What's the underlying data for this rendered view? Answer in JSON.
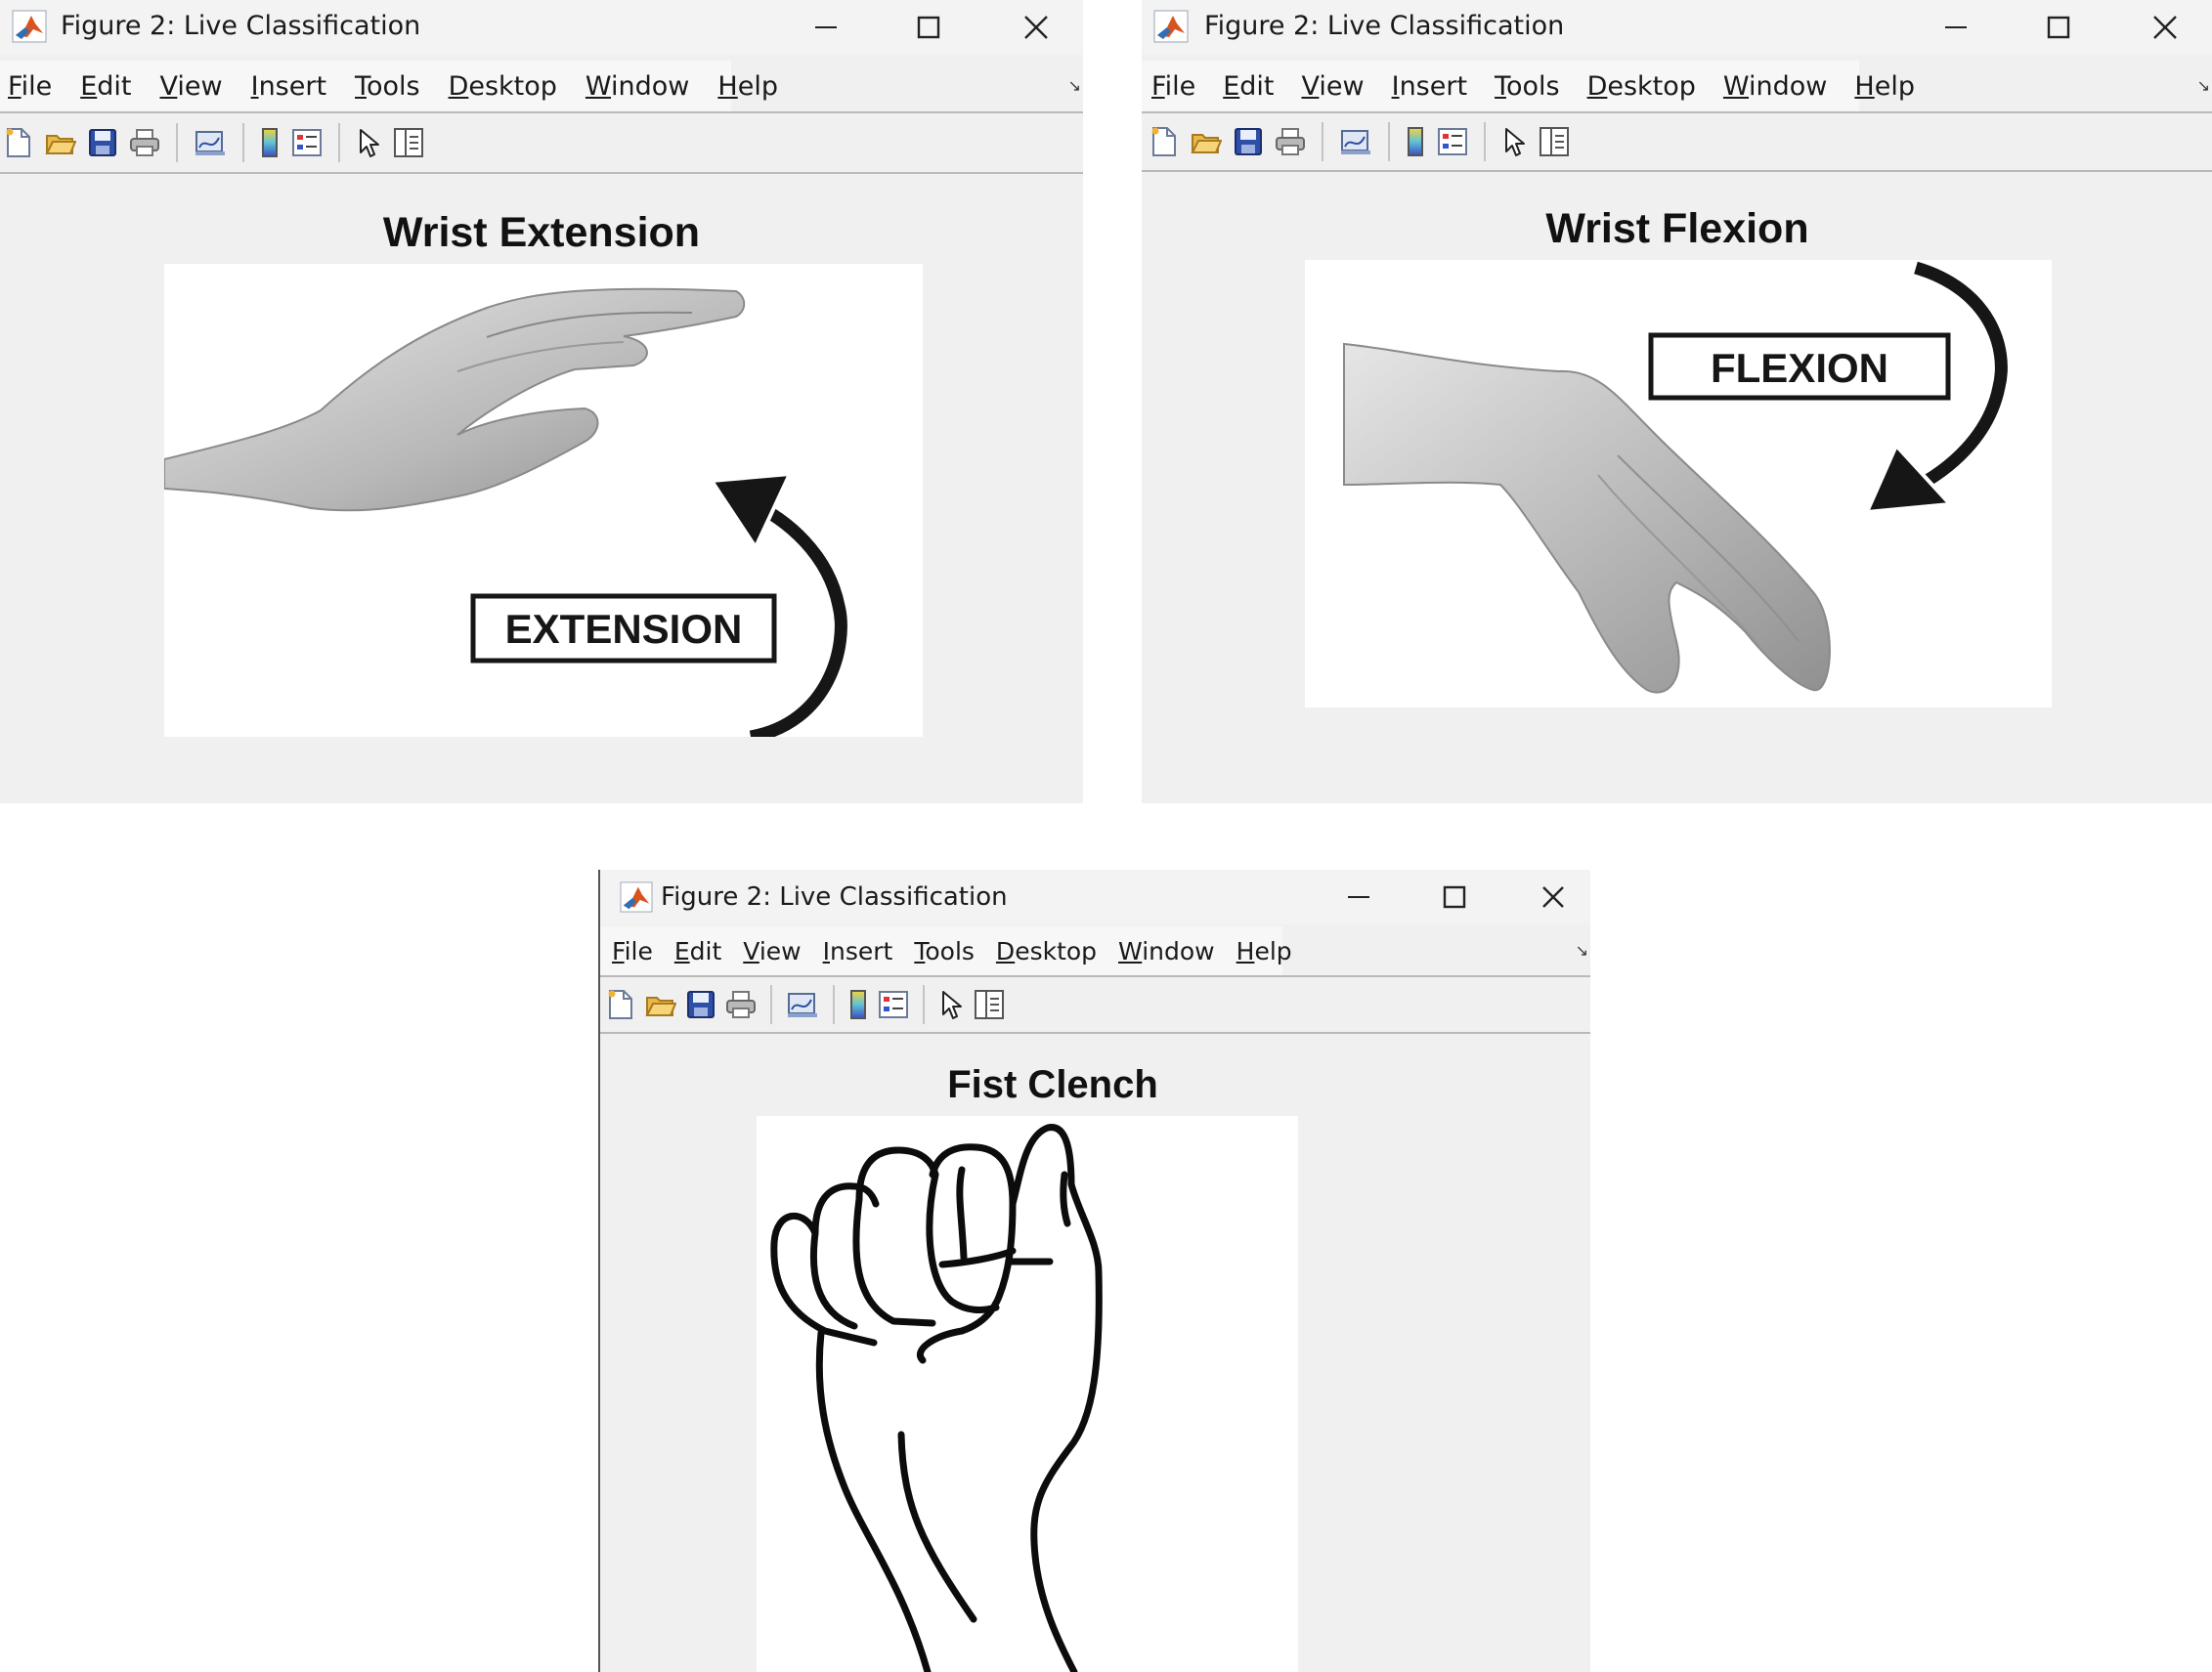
{
  "windows": [
    {
      "title": "Figure 2: Live Classification",
      "plot_title": "Wrist Extension",
      "label": "EXTENSION"
    },
    {
      "title": "Figure 2: Live Classification",
      "plot_title": "Wrist Flexion",
      "label": "FLEXION"
    },
    {
      "title": "Figure 2: Live Classification",
      "plot_title": "Fist Clench"
    }
  ],
  "menu": {
    "file": {
      "key": "F",
      "rest": "ile"
    },
    "edit": {
      "key": "E",
      "rest": "dit"
    },
    "view": {
      "key": "V",
      "rest": "iew"
    },
    "insert": {
      "key": "I",
      "rest": "nsert"
    },
    "tools": {
      "key": "T",
      "rest": "ools"
    },
    "desktop": {
      "key": "D",
      "rest": "esktop"
    },
    "window": {
      "key": "W",
      "rest": "indow"
    },
    "help": {
      "key": "H",
      "rest": "elp"
    }
  },
  "icons": [
    "matlab-logo-icon",
    "minimize-icon",
    "maximize-icon",
    "close-icon",
    "new-figure-icon",
    "open-file-icon",
    "save-icon",
    "print-icon",
    "link-plot-icon",
    "colorbar-icon",
    "legend-icon",
    "edit-plot-arrow-icon",
    "property-inspector-icon"
  ],
  "colors": {
    "window_bg": "#f0f0f0",
    "titlebar_bg": "#f3f3f3",
    "axes_bg": "#ffffff",
    "ink": "#111111"
  }
}
